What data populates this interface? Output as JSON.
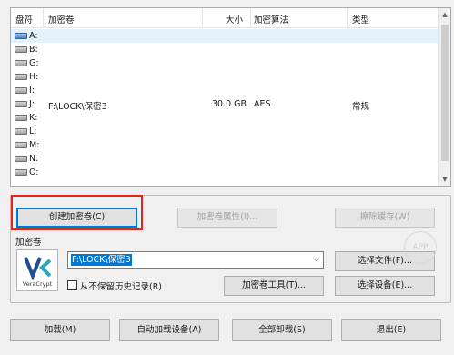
{
  "volume_list": {
    "columns": [
      "盘符",
      "加密卷",
      "大小",
      "加密算法",
      "类型"
    ],
    "rows": [
      {
        "drive": "A:",
        "volume": "",
        "size": "",
        "algorithm": "",
        "type": "",
        "selected": true
      },
      {
        "drive": "B:",
        "volume": "",
        "size": "",
        "algorithm": "",
        "type": ""
      },
      {
        "drive": "G:",
        "volume": "",
        "size": "",
        "algorithm": "",
        "type": ""
      },
      {
        "drive": "H:",
        "volume": "",
        "size": "",
        "algorithm": "",
        "type": ""
      },
      {
        "drive": "I:",
        "volume": "",
        "size": "",
        "algorithm": "",
        "type": ""
      },
      {
        "drive": "J:",
        "volume": "F:\\LOCK\\保密3",
        "size": "30.0 GB",
        "algorithm": "AES",
        "type": "常规"
      },
      {
        "drive": "K:",
        "volume": "",
        "size": "",
        "algorithm": "",
        "type": ""
      },
      {
        "drive": "L:",
        "volume": "",
        "size": "",
        "algorithm": "",
        "type": ""
      },
      {
        "drive": "M:",
        "volume": "",
        "size": "",
        "algorithm": "",
        "type": ""
      },
      {
        "drive": "N:",
        "volume": "",
        "size": "",
        "algorithm": "",
        "type": ""
      },
      {
        "drive": "O:",
        "volume": "",
        "size": "",
        "algorithm": "",
        "type": ""
      }
    ]
  },
  "actions": {
    "create_volume": "创建加密卷(C)",
    "volume_properties": "加密卷属性(I)...",
    "wipe_cache": "擦除缓存(W)"
  },
  "volume_group": {
    "label": "加密卷",
    "logo_text": "VeraCrypt",
    "path_value": "F:\\LOCK\\保密3",
    "never_save_history": "从不保留历史记录(R)",
    "select_file": "选择文件(F)...",
    "volume_tools": "加密卷工具(T)...",
    "select_device": "选择设备(E)..."
  },
  "bottom": {
    "mount": "加载(M)",
    "auto_mount": "自动加载设备(A)",
    "dismount_all": "全部卸载(S)",
    "exit": "退出(E)"
  },
  "watermark": "APP",
  "colors": {
    "selection": "#e5f1fb",
    "highlight": "#0078d7",
    "annotation": "#e8231d"
  }
}
